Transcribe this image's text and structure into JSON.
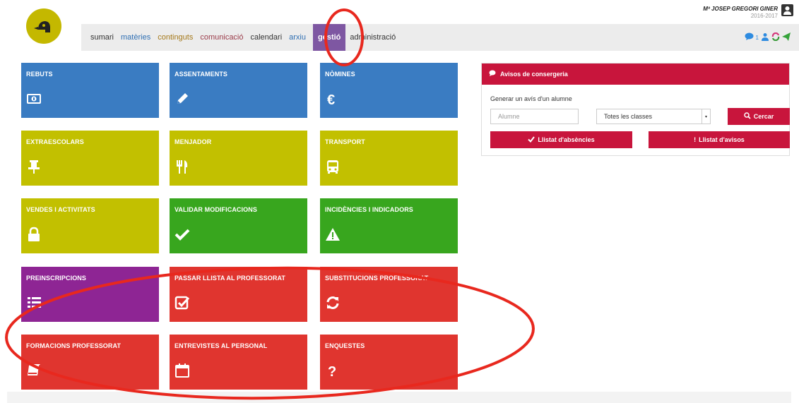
{
  "user": {
    "name": "Mª JOSEP GREGORI GINER",
    "year": "2016-2017"
  },
  "nav": {
    "items": [
      {
        "label": "sumari",
        "color": "#333333"
      },
      {
        "label": "matèries",
        "color": "#2f6fb3"
      },
      {
        "label": "continguts",
        "color": "#a5791b"
      },
      {
        "label": "comunicació",
        "color": "#9b3c4a"
      },
      {
        "label": "calendari",
        "color": "#333333"
      },
      {
        "label": "arxiu",
        "color": "#2f6fb3"
      },
      {
        "label": "gestió",
        "color": "#ffffff",
        "active": true
      },
      {
        "label": "administració",
        "color": "#333333"
      }
    ],
    "badge": "1"
  },
  "tiles": [
    {
      "id": "rebuts",
      "label": "REBUTS",
      "icon": "banknote-icon",
      "color": "#3a7cc2"
    },
    {
      "id": "assentaments",
      "label": "ASSENTAMENTS",
      "icon": "pencil-icon",
      "color": "#3a7cc2"
    },
    {
      "id": "nomines",
      "label": "NÒMINES",
      "icon": "euro-icon",
      "color": "#3a7cc2"
    },
    {
      "id": "extraescolars",
      "label": "EXTRAESCOLARS",
      "icon": "pushpin-icon",
      "color": "#c2c000"
    },
    {
      "id": "menjador",
      "label": "MENJADOR",
      "icon": "cutlery-icon",
      "color": "#c2c000"
    },
    {
      "id": "transport",
      "label": "TRANSPORT",
      "icon": "bus-icon",
      "color": "#c2c000"
    },
    {
      "id": "vendes",
      "label": "VENDES I ACTIVITATS",
      "icon": "lock-icon",
      "color": "#c2c000"
    },
    {
      "id": "validar",
      "label": "VALIDAR MODIFICACIONS",
      "icon": "checkmark-icon",
      "color": "#38a61e"
    },
    {
      "id": "incidencies",
      "label": "INCIDÈNCIES I INDICADORS",
      "icon": "warning-icon",
      "color": "#38a61e"
    },
    {
      "id": "preinscripcions",
      "label": "PREINSCRIPCIONS",
      "icon": "list-icon",
      "color": "#8e2594"
    },
    {
      "id": "passar-llista",
      "label": "PASSAR LLISTA AL PROFESSORAT",
      "icon": "checkbox-icon",
      "color": "#e0352f"
    },
    {
      "id": "substitucions",
      "label": "SUBSTITUCIONS PROFESSORAT",
      "icon": "refresh-icon",
      "color": "#e0352f"
    },
    {
      "id": "formacions",
      "label": "FORMACIONS PROFESSORAT",
      "icon": "book-icon",
      "color": "#e0352f"
    },
    {
      "id": "entrevistes",
      "label": "ENTREVISTES AL PERSONAL",
      "icon": "calendar-icon",
      "color": "#e0352f"
    },
    {
      "id": "enquestes",
      "label": "ENQUESTES",
      "icon": "question-icon",
      "color": "#e0352f"
    }
  ],
  "panel": {
    "title": "Avisos de consergeria",
    "subtitle": "Generar un avís d'un alumne",
    "student_placeholder": "Alumne",
    "class_select": "Totes les classes",
    "search_label": "Cercar",
    "absences_label": "Llistat d'absències",
    "notices_label": "Llistat d'avisos"
  },
  "annotation_color": "#e8281e"
}
